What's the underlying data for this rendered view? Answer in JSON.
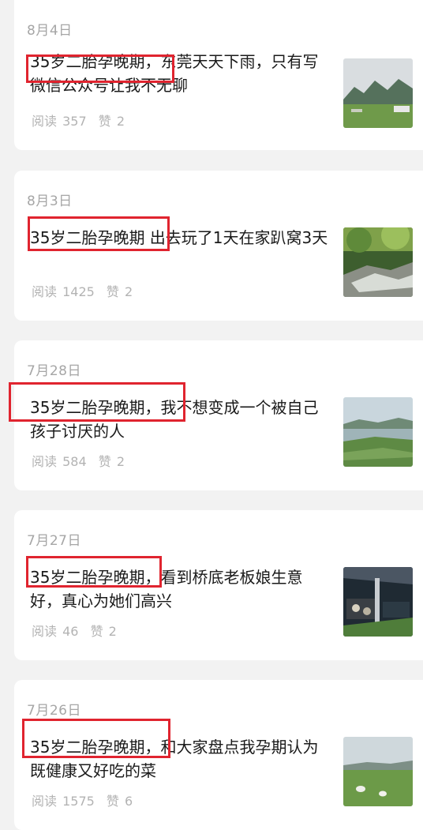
{
  "posts": [
    {
      "date": "8月4日",
      "title": "35岁二胎孕晚期，东莞天天下雨，只有写微信公众号让我不无聊",
      "read_label": "阅读",
      "reads": "357",
      "like_label": "赞",
      "likes": "2",
      "thumb_icon": "mountain-meadow-photo"
    },
    {
      "date": "8月3日",
      "title": "35岁二胎孕晚期  出去玩了1天在家趴窝3天",
      "read_label": "阅读",
      "reads": "1425",
      "like_label": "赞",
      "likes": "2",
      "thumb_icon": "forest-stream-photo"
    },
    {
      "date": "7月28日",
      "title": "35岁二胎孕晚期，我不想变成一个被自己孩子讨厌的人",
      "read_label": "阅读",
      "reads": "584",
      "like_label": "赞",
      "likes": "2",
      "thumb_icon": "lake-landscape-photo"
    },
    {
      "date": "7月27日",
      "title": "35岁二胎孕晚期，看到桥底老板娘生意好，真心为她们高兴",
      "read_label": "阅读",
      "reads": "46",
      "like_label": "赞",
      "likes": "2",
      "thumb_icon": "night-market-photo"
    },
    {
      "date": "7月26日",
      "title": "35岁二胎孕晚期，和大家盘点我孕期认为既健康又好吃的菜",
      "read_label": "阅读",
      "reads": "1575",
      "like_label": "赞",
      "likes": "6",
      "thumb_icon": "grassland-sheep-photo"
    }
  ],
  "colors": {
    "highlight": "#e0242f",
    "background": "#f2f2f2",
    "card": "#ffffff"
  }
}
